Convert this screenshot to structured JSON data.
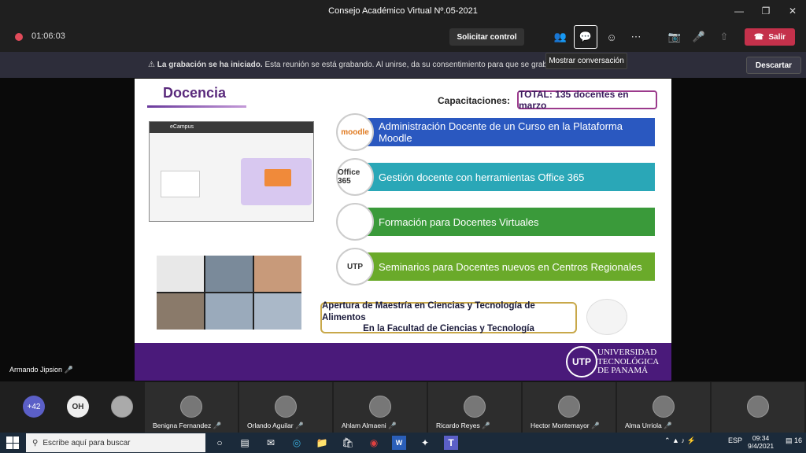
{
  "window": {
    "title": "Consejo Académico Virtual Nº.05-2021"
  },
  "toolbar": {
    "timer": "01:06:03",
    "request_control": "Solicitar control",
    "leave": "Salir"
  },
  "banner": {
    "bold": "La grabación se ha iniciado.",
    "text": "Esta reunión se está grabando. Al unirse, da su consentimiento para que se grabe. Polític",
    "discard": "Descartar"
  },
  "tooltip": "Mostrar conversación",
  "slide": {
    "title": "Docencia",
    "cap_label": "Capacitaciones:",
    "total": "TOTAL: 135 docentes en marzo",
    "rows": [
      {
        "label": "Administración Docente de un Curso en la Plataforma Moodle",
        "color": "#2a58c0",
        "icon": "moodle"
      },
      {
        "label": "Gestión docente con herramientas Office 365",
        "color": "#2aa7b7",
        "icon": "Office 365"
      },
      {
        "label": "Formación para Docentes Virtuales",
        "color": "#3a9a3a",
        "icon": ""
      },
      {
        "label": "Seminarios para Docentes nuevos en Centros Regionales",
        "color": "#6aaa2a",
        "icon": "UTP"
      }
    ],
    "maestria_line1": "Apertura de Maestría en Ciencias y Tecnología de Alimentos",
    "maestria_line2": "En la Facultad de Ciencias y Tecnología",
    "screenshot_title": "eCampus",
    "utp_logo": "UTP",
    "utp_line1": "UNIVERSIDAD",
    "utp_line2": "TECNOLÓGICA",
    "utp_line3": "DE PANAMÁ"
  },
  "speaker": "Armando Jipsion",
  "participants": {
    "overflow_count": "+42",
    "oh_initials": "OH",
    "tiles": [
      {
        "name": "Benigna Fernandez"
      },
      {
        "name": "Orlando Aguilar"
      },
      {
        "name": "Ahlam Almaeni"
      },
      {
        "name": "Ricardo Reyes"
      },
      {
        "name": "Hector Montemayor"
      },
      {
        "name": "Alma Urriola"
      },
      {
        "name": ""
      }
    ]
  },
  "taskbar": {
    "search_placeholder": "Escribe aquí para buscar",
    "lang": "ESP",
    "time": "09:34",
    "date": "9/4/2021",
    "notifications": "16"
  }
}
